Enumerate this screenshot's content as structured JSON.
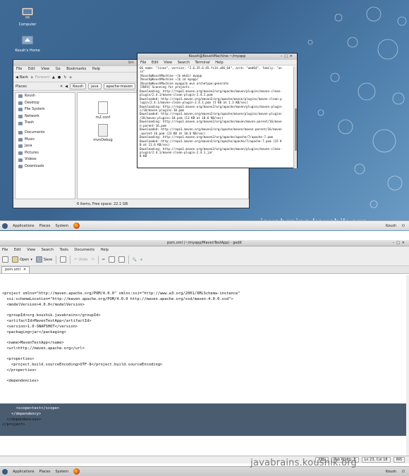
{
  "desktop": {
    "icons": [
      {
        "label": "Computer"
      },
      {
        "label": "Koush's Home"
      }
    ]
  },
  "nautilus": {
    "title": "bin",
    "menu": [
      "File",
      "Edit",
      "View",
      "Go",
      "Bookmarks",
      "Help"
    ],
    "back_label": "Back",
    "forward_label": "Forward",
    "places_label": "Places",
    "crumbs": [
      "Koush",
      "java",
      "apache-maven"
    ],
    "sidebar": [
      "Koush",
      "Desktop",
      "File System",
      "Network",
      "Trash",
      "Documents",
      "Music",
      "Java",
      "Pictures",
      "Videos",
      "Downloads"
    ],
    "files": [
      "m2.conf",
      "mvnDebug",
      "mvn"
    ],
    "status": "6 items, Free space: 22.1 GB"
  },
  "terminal": {
    "title": "Koush@KoushMachine:~/myapp",
    "menu": [
      "File",
      "Edit",
      "View",
      "Search",
      "Terminal",
      "Help"
    ],
    "lines": [
      "OS name: \"linux\", version: \"2.6.35.6-45.fc14.x86_64\", arch: \"amd64\", family: \"un",
      "ix\"",
      "[Koush@KoushMachine ~]$ mkdir myapp",
      "[Koush@KoushMachine ~]$ cd myapp/",
      "[Koush@KoushMachine myapp]$ mvn archetype:generate",
      "[INFO] Scanning for projects...",
      "Downloading: http://repo1.maven.org/maven2/org/apache/maven/plugins/maven-clean-",
      "plugin/2.4.1/maven-clean-plugin-2.4.1.pom",
      "Downloaded: http://repo1.maven.org/maven2/org/apache/maven/plugins/maven-clean-p",
      "lugin/2.4.1/maven-clean-plugin-2.4.1.pom (5 KB at 1.3 KB/sec)",
      "Downloading: http://repo1.maven.org/maven2/org/apache/maven/plugins/maven-plugin",
      "s/18/maven-plugins-18.pom",
      "Downloaded: http://repo1.maven.org/maven2/org/apache/maven/plugins/maven-plugins",
      "/18/maven-plugins-18.pom (13 KB at 10.6 KB/sec)",
      "Downloading: http://repo1.maven.org/maven2/org/apache/maven/maven-parent/16/mave",
      "n-parent-16.pom",
      "Downloaded: http://repo1.maven.org/maven2/org/apache/maven/maven-parent/16/maven",
      "-parent-16.pom (23 KB at 10.6 KB/sec)",
      "Downloading: http://repo1.maven.org/maven2/org/apache/apache/7/apache-7.pom",
      "Downloaded: http://repo1.maven.org/maven2/org/apache/apache/7/apache-7.pom (15 K",
      "B at 11.6 KB/sec)",
      "Downloading: http://repo1.maven.org/maven2/org/apache/maven/plugins/maven-clean-",
      "plugin/2.4.1/maven-clean-plugin-2.4.1.jar",
      "8 KB"
    ]
  },
  "top_panel": {
    "items": [
      "Applications",
      "Places",
      "System"
    ],
    "user": "Koush",
    "watermark": "javabrains.koushik.org"
  },
  "gedit": {
    "title": "pom.xml (~/myapp/MavenTestApp) - gedit",
    "menu": [
      "File",
      "Edit",
      "View",
      "Search",
      "Tools",
      "Documents",
      "Help"
    ],
    "toolbar": {
      "open": "Open",
      "save": "Save",
      "undo": "Undo"
    },
    "tab": "pom.xml",
    "lines": [
      "<project xmlns=\"http://maven.apache.org/POM/4.0.0\" xmlns:xsi=\"http://www.w3.org/2001/XMLSchema-instance\"",
      "  xsi:schemaLocation=\"http://maven.apache.org/POM/4.0.0 http://maven.apache.org/xsd/maven-4.0.0.xsd\">",
      "  <modelVersion>4.0.0</modelVersion>",
      "",
      "  <groupId>org.koushik.javabrains</groupId>",
      "  <artifactId>MavenTestApp</artifactId>",
      "  <version>1.0-SNAPSHOT</version>",
      "  <packaging>jar</packaging>",
      "",
      "  <name>MavenTestApp</name>",
      "  <url>http://maven.apache.org</url>",
      "",
      "  <properties>",
      "    <project.build.sourceEncoding>UTF-8</project.build.sourceEncoding>",
      "  </properties>",
      "",
      "  <dependencies>",
      "    <dependency>",
      "      <groupId>junit</groupId>",
      "      <artifactId>junit</artifactId>",
      "      <version>3.8.1</version>",
      "      <scope>test</scope>",
      "    </dependency>",
      "  </dependencies>",
      "</project>"
    ],
    "status": {
      "lang": "XML",
      "tab_width": "Tab Width: 8",
      "position": "Ln 23, Col 18",
      "mode": "INS"
    }
  },
  "bottom_panel": {
    "items": [
      "Applications",
      "Places",
      "System"
    ],
    "user": "Koush",
    "watermark": "javabrains.koushik.org"
  }
}
